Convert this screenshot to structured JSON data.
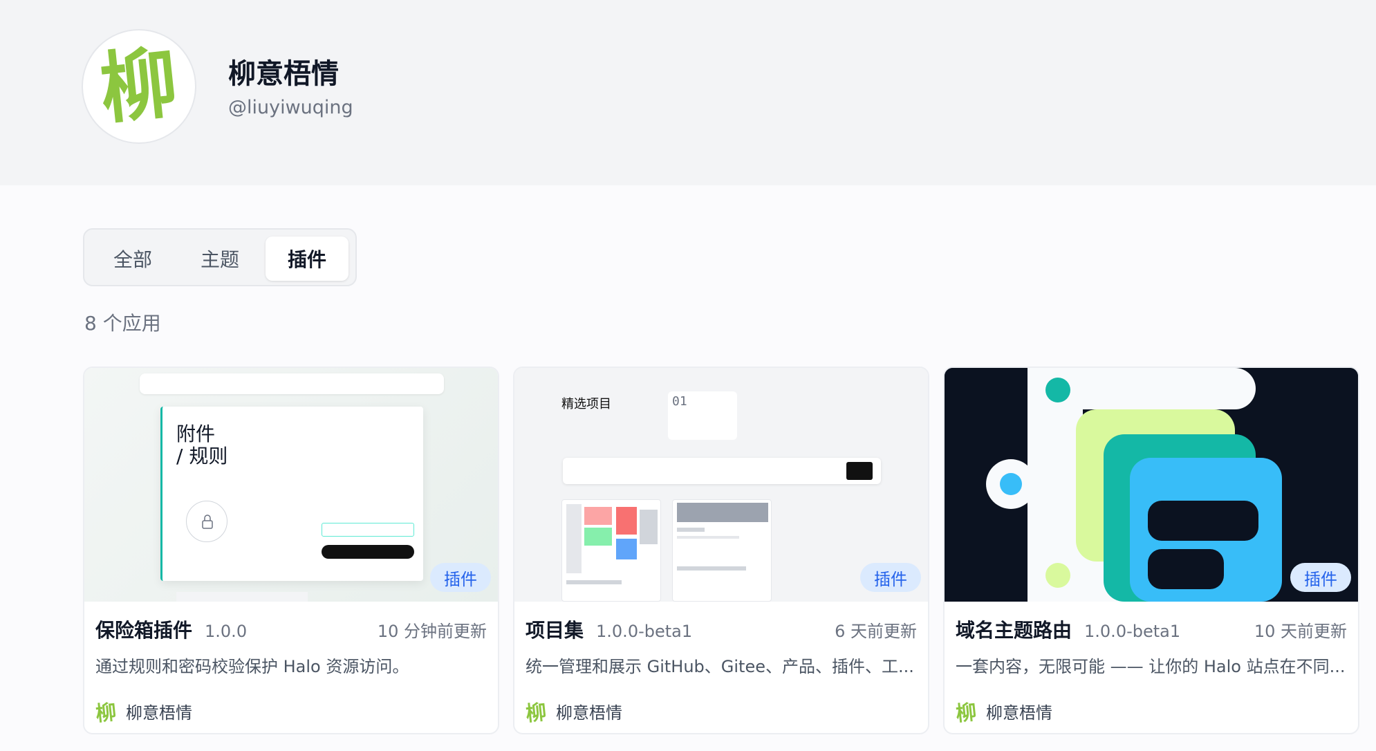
{
  "profile": {
    "name": "柳意梧情",
    "handle": "@liuyiwuqing",
    "avatar_glyph": "柳"
  },
  "tabs": [
    {
      "label": "全部",
      "active": false
    },
    {
      "label": "主题",
      "active": false
    },
    {
      "label": "插件",
      "active": true
    }
  ],
  "app_count": "8 个应用",
  "cards": [
    {
      "title": "保险箱插件",
      "version": "1.0.0",
      "updated": "10 分钟前更新",
      "description": "通过规则和密码校验保护 Halo 资源访问。",
      "badge": "插件",
      "author": "柳意梧情",
      "cover_text": "附件\n/  规则"
    },
    {
      "title": "项目集",
      "version": "1.0.0-beta1",
      "updated": "6 天前更新",
      "description": "统一管理和展示 GitHub、Gitee、产品、插件、工...",
      "badge": "插件",
      "author": "柳意梧情",
      "cover_text": "精选项目",
      "cover_num": "01"
    },
    {
      "title": "域名主题路由",
      "version": "1.0.0-beta1",
      "updated": "10 天前更新",
      "description": "一套内容，无限可能 —— 让你的 Halo 站点在不同...",
      "badge": "插件",
      "author": "柳意梧情"
    }
  ],
  "colors": {
    "accent": "#2563eb",
    "badge_bg": "#dbeafe",
    "logo_green": "#8cc63f",
    "teal": "#14b8a6",
    "sky": "#38bdf8",
    "lime": "#d9f99d"
  },
  "icons": {
    "avatar": "willow-glyph-icon",
    "lock": "lock-icon"
  }
}
